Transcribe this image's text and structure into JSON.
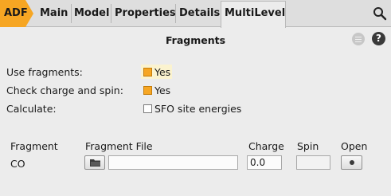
{
  "tabs": {
    "adf": "ADF",
    "items": [
      "Main",
      "Model",
      "Properties",
      "Details",
      "MultiLevel"
    ],
    "active": "MultiLevel"
  },
  "header": {
    "title": "Fragments",
    "help_glyph": "?"
  },
  "options": {
    "use_fragments": {
      "label": "Use fragments:",
      "value": "Yes",
      "checked": true
    },
    "check_charge_spin": {
      "label": "Check charge and spin:",
      "value": "Yes",
      "checked": true
    },
    "calculate": {
      "label": "Calculate:",
      "value": "SFO site energies",
      "checked": false
    }
  },
  "table": {
    "columns": [
      "Fragment",
      "Fragment File",
      "Charge",
      "Spin",
      "Open"
    ],
    "rows": [
      {
        "fragment": "CO",
        "file": "",
        "charge": "0.0",
        "spin": ""
      }
    ]
  },
  "colors": {
    "accent": "#f6a623",
    "highlight": "#fbf3cf"
  },
  "icons": [
    "search-icon",
    "menu-icon",
    "help-icon",
    "folder-icon"
  ]
}
